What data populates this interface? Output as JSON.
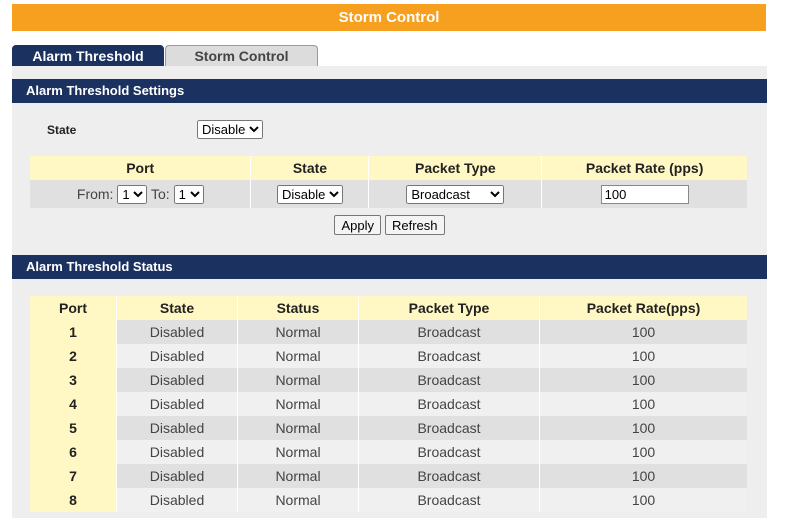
{
  "page_title": "Storm Control",
  "tabs": [
    {
      "label": "Alarm Threshold"
    },
    {
      "label": "Storm Control"
    }
  ],
  "settings": {
    "header": "Alarm Threshold Settings",
    "state_label": "State",
    "state_value": "Disable",
    "columns": [
      "Port",
      "State",
      "Packet Type",
      "Packet Rate (pps)"
    ],
    "from_label": "From:",
    "from_value": "1",
    "to_label": "To:",
    "to_value": "1",
    "row_state": "Disable",
    "packet_type": "Broadcast",
    "packet_rate": "100",
    "apply_label": "Apply",
    "refresh_label": "Refresh"
  },
  "status": {
    "header": "Alarm Threshold Status",
    "columns": [
      "Port",
      "State",
      "Status",
      "Packet Type",
      "Packet Rate(pps)"
    ],
    "rows": [
      {
        "port": "1",
        "state": "Disabled",
        "status": "Normal",
        "packet_type": "Broadcast",
        "rate": "100"
      },
      {
        "port": "2",
        "state": "Disabled",
        "status": "Normal",
        "packet_type": "Broadcast",
        "rate": "100"
      },
      {
        "port": "3",
        "state": "Disabled",
        "status": "Normal",
        "packet_type": "Broadcast",
        "rate": "100"
      },
      {
        "port": "4",
        "state": "Disabled",
        "status": "Normal",
        "packet_type": "Broadcast",
        "rate": "100"
      },
      {
        "port": "5",
        "state": "Disabled",
        "status": "Normal",
        "packet_type": "Broadcast",
        "rate": "100"
      },
      {
        "port": "6",
        "state": "Disabled",
        "status": "Normal",
        "packet_type": "Broadcast",
        "rate": "100"
      },
      {
        "port": "7",
        "state": "Disabled",
        "status": "Normal",
        "packet_type": "Broadcast",
        "rate": "100"
      },
      {
        "port": "8",
        "state": "Disabled",
        "status": "Normal",
        "packet_type": "Broadcast",
        "rate": "100"
      }
    ]
  }
}
